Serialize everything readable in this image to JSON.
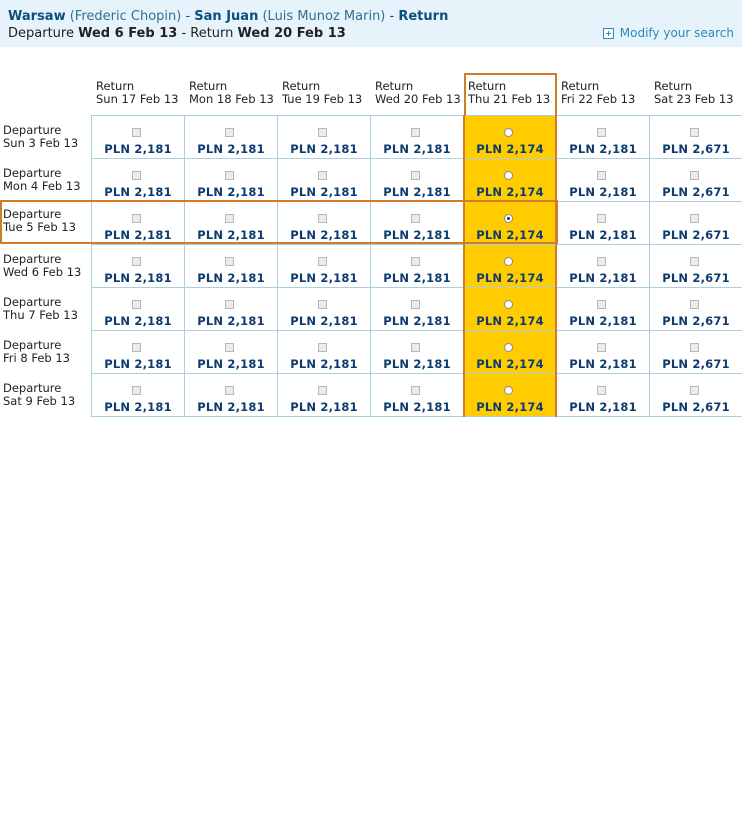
{
  "header": {
    "origin_city": "Warsaw",
    "origin_airport": "(Frederic Chopin)",
    "separator1": " - ",
    "dest_city": "San Juan",
    "dest_airport": "(Luis Munoz Marin)",
    "separator2": " - ",
    "trip_type": "Return",
    "departure_label": "Departure",
    "departure_date": "Wed 6 Feb 13",
    "return_sep": " - Return ",
    "return_date": "Wed 20 Feb 13",
    "modify_label": "Modify your search"
  },
  "columns": [
    {
      "label": "Return",
      "date": "Sun 17 Feb 13"
    },
    {
      "label": "Return",
      "date": "Mon 18 Feb 13"
    },
    {
      "label": "Return",
      "date": "Tue 19 Feb 13"
    },
    {
      "label": "Return",
      "date": "Wed 20 Feb 13"
    },
    {
      "label": "Return",
      "date": "Thu 21 Feb 13"
    },
    {
      "label": "Return",
      "date": "Fri 22 Feb 13"
    },
    {
      "label": "Return",
      "date": "Sat 23 Feb 13"
    }
  ],
  "rows": [
    {
      "label": "Departure",
      "date": "Sun 3 Feb 13",
      "prices": [
        "PLN 2,181",
        "PLN 2,181",
        "PLN 2,181",
        "PLN 2,181",
        "PLN 2,174",
        "PLN 2,181",
        "PLN 2,671"
      ]
    },
    {
      "label": "Departure",
      "date": "Mon 4 Feb 13",
      "prices": [
        "PLN 2,181",
        "PLN 2,181",
        "PLN 2,181",
        "PLN 2,181",
        "PLN 2,174",
        "PLN 2,181",
        "PLN 2,671"
      ]
    },
    {
      "label": "Departure",
      "date": "Tue 5 Feb 13",
      "prices": [
        "PLN 2,181",
        "PLN 2,181",
        "PLN 2,181",
        "PLN 2,181",
        "PLN 2,174",
        "PLN 2,181",
        "PLN 2,671"
      ]
    },
    {
      "label": "Departure",
      "date": "Wed 6 Feb 13",
      "prices": [
        "PLN 2,181",
        "PLN 2,181",
        "PLN 2,181",
        "PLN 2,181",
        "PLN 2,174",
        "PLN 2,181",
        "PLN 2,671"
      ]
    },
    {
      "label": "Departure",
      "date": "Thu 7 Feb 13",
      "prices": [
        "PLN 2,181",
        "PLN 2,181",
        "PLN 2,181",
        "PLN 2,181",
        "PLN 2,174",
        "PLN 2,181",
        "PLN 2,671"
      ]
    },
    {
      "label": "Departure",
      "date": "Fri 8 Feb 13",
      "prices": [
        "PLN 2,181",
        "PLN 2,181",
        "PLN 2,181",
        "PLN 2,181",
        "PLN 2,174",
        "PLN 2,181",
        "PLN 2,671"
      ]
    },
    {
      "label": "Departure",
      "date": "Sat 9 Feb 13",
      "prices": [
        "PLN 2,181",
        "PLN 2,181",
        "PLN 2,181",
        "PLN 2,181",
        "PLN 2,174",
        "PLN 2,181",
        "PLN 2,671"
      ]
    }
  ],
  "selected_return_index": 4,
  "selected_departure_index": 2,
  "colors": {
    "highlight": "#ffcc00",
    "selection_border": "#d07c2a",
    "price_text": "#0d3b6f",
    "header_bg": "#e6f3fa"
  }
}
